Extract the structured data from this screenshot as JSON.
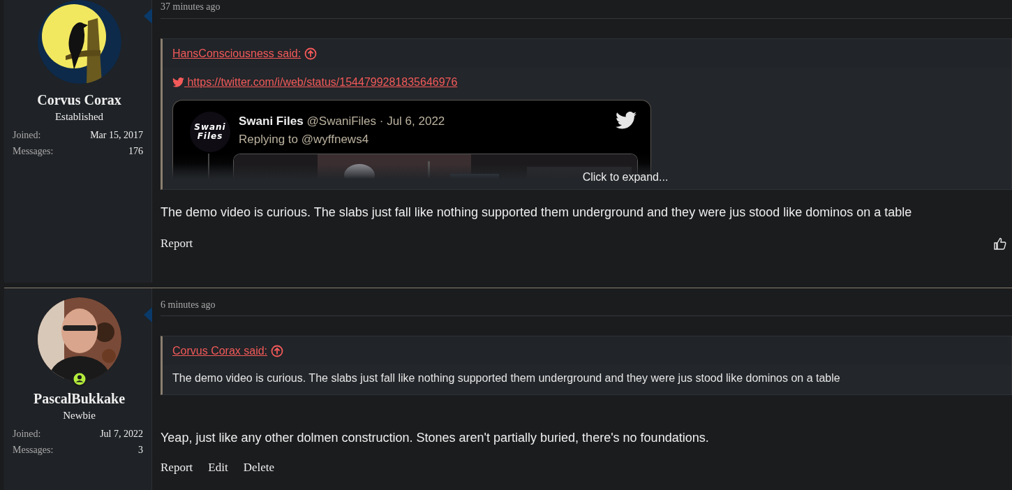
{
  "posts": [
    {
      "author": {
        "name": "Corvus Corax",
        "title": "Established",
        "online": false,
        "stats": [
          {
            "label": "Joined:",
            "value": "Mar 15, 2017"
          },
          {
            "label": "Messages:",
            "value": "176"
          }
        ]
      },
      "time": "37 minutes ago",
      "quote": {
        "attribution": "HansConsciousness said:",
        "link": " https://twitter.com/i/web/status/1544799281835646976",
        "embed": {
          "avatar_text": "Swani Files",
          "name": "Swani Files",
          "meta": "@SwaniFiles · Jul 6, 2022",
          "replying": "Replying to @wyffnews4"
        },
        "expand": "Click to expand..."
      },
      "body": "The demo video is curious. The slabs just fall like nothing supported them underground and they were jus stood like dominos on a table",
      "actions": [
        "Report"
      ],
      "like": true
    },
    {
      "author": {
        "name": "PascalBukkake",
        "title": "Newbie",
        "online": true,
        "stats": [
          {
            "label": "Joined:",
            "value": "Jul 7, 2022"
          },
          {
            "label": "Messages:",
            "value": "3"
          }
        ]
      },
      "time": "6 minutes ago",
      "quote": {
        "attribution": "Corvus Corax said:",
        "text": "The demo video is curious. The slabs just fall like nothing supported them underground and they were jus stood like dominos on a table"
      },
      "body": "Yeap, just like any other dolmen construction. Stones aren't partially buried, there's no foundations.",
      "actions": [
        "Report",
        "Edit",
        "Delete"
      ],
      "like": false
    }
  ]
}
